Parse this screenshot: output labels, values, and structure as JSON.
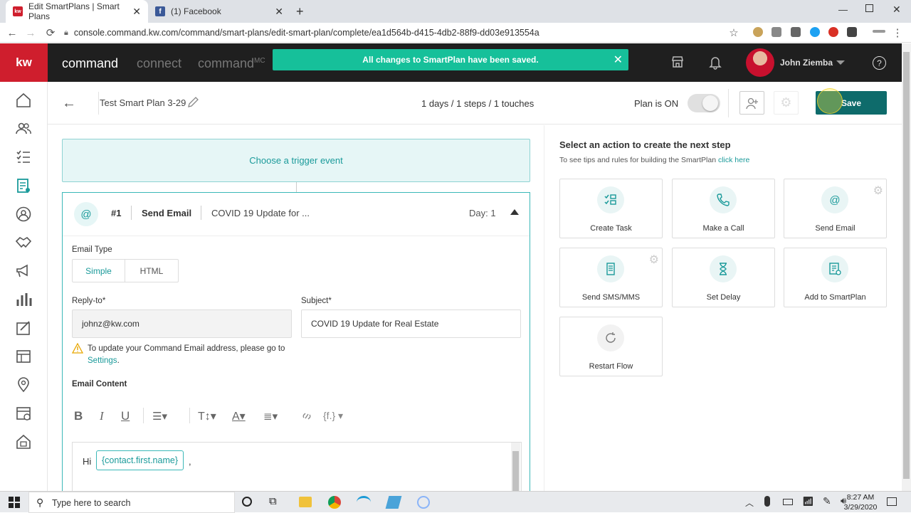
{
  "browser": {
    "tabs": [
      {
        "title": "Edit SmartPlans | Smart Plans",
        "favicon": "kw-favicon",
        "active": true
      },
      {
        "title": "(1) Facebook",
        "favicon": "facebook-favicon",
        "active": false
      }
    ],
    "new_tab": "+",
    "url": "console.command.kw.com/command/smart-plans/edit-smart-plan/complete/ea1d564b-d415-4db2-88f9-dd03e913554a"
  },
  "header": {
    "logo": "kw",
    "nav": [
      "command",
      "connect",
      "command"
    ],
    "nav_sup": "MC",
    "toast": "All changes to SmartPlan have been saved.",
    "user_name": "John Ziemba"
  },
  "toolbar": {
    "plan_name": "Test Smart Plan 3-29",
    "summary": "1 days / 1 steps / 1 touches",
    "plan_on_label": "Plan is ON",
    "save_label": "Save"
  },
  "trigger": {
    "label": "Choose a trigger event"
  },
  "step": {
    "icon": "@",
    "number": "#1",
    "type": "Send Email",
    "preview": "COVID 19 Update for ...",
    "day": "Day: 1",
    "email_type_label": "Email Type",
    "email_type_options": [
      "Simple",
      "HTML"
    ],
    "reply_to_label": "Reply-to*",
    "reply_to_value": "johnz@kw.com",
    "subject_label": "Subject*",
    "subject_value": "COVID 19 Update for Real Estate",
    "warning_text": "To update your Command Email address, please go to",
    "settings_link": "Settings",
    "warning_end": ".",
    "content_label": "Email Content",
    "editor_hi": "Hi",
    "editor_token": "{contact.first.name}",
    "editor_comma": ","
  },
  "actions": {
    "title": "Select an action to create the next step",
    "subtitle": "To see tips and rules for building the SmartPlan",
    "subtitle_link": "click here",
    "items": [
      {
        "label": "Create Task",
        "icon": "create-task-icon"
      },
      {
        "label": "Make a Call",
        "icon": "phone-icon"
      },
      {
        "label": "Send Email",
        "icon": "at-icon"
      },
      {
        "label": "Send SMS/MMS",
        "icon": "sms-icon"
      },
      {
        "label": "Set Delay",
        "icon": "hourglass-icon"
      },
      {
        "label": "Add to SmartPlan",
        "icon": "smartplan-icon"
      },
      {
        "label": "Restart Flow",
        "icon": "restart-icon"
      }
    ]
  },
  "taskbar": {
    "search_placeholder": "Type here to search",
    "time": "8:27 AM",
    "date": "3/29/2020"
  },
  "colors": {
    "brand_red": "#cf1e2d",
    "teal": "#1a9a9a",
    "toast": "#16c09a",
    "save": "#0e6b6b"
  }
}
